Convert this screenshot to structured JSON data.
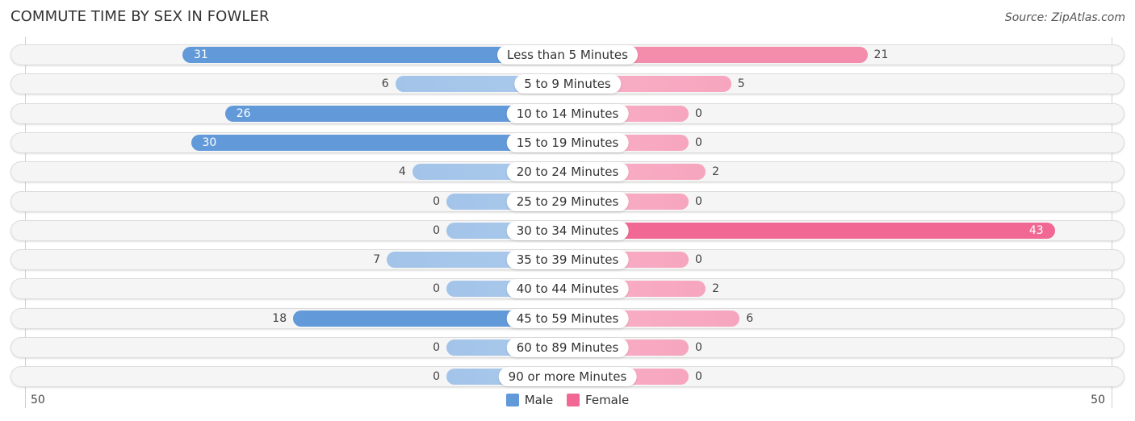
{
  "title": "COMMUTE TIME BY SEX IN FOWLER",
  "source": "Source: ZipAtlas.com",
  "colors": {
    "male_strong": "#6199d9",
    "male_light": "#a3c4e9",
    "female_strong": "#f06893",
    "female_light": "#f7a5bf",
    "male_legend": "#6199d9",
    "female_legend": "#f06893"
  },
  "chart_data": {
    "type": "bar",
    "orientation": "horizontal-diverging",
    "title": "COMMUTE TIME BY SEX IN FOWLER",
    "categories": [
      "Less than 5 Minutes",
      "5 to 9 Minutes",
      "10 to 14 Minutes",
      "15 to 19 Minutes",
      "20 to 24 Minutes",
      "25 to 29 Minutes",
      "30 to 34 Minutes",
      "35 to 39 Minutes",
      "40 to 44 Minutes",
      "45 to 59 Minutes",
      "60 to 89 Minutes",
      "90 or more Minutes"
    ],
    "series": [
      {
        "name": "Male",
        "values": [
          31,
          6,
          26,
          30,
          4,
          0,
          0,
          7,
          0,
          18,
          0,
          0
        ]
      },
      {
        "name": "Female",
        "values": [
          21,
          5,
          0,
          0,
          2,
          0,
          43,
          0,
          2,
          6,
          0,
          0
        ]
      }
    ],
    "axis": {
      "left_tick": "50",
      "right_tick": "50",
      "range": [
        0,
        50
      ]
    },
    "legend": {
      "position": "bottom-center",
      "entries": [
        "Male",
        "Female"
      ]
    },
    "xlabel": "",
    "ylabel": ""
  }
}
